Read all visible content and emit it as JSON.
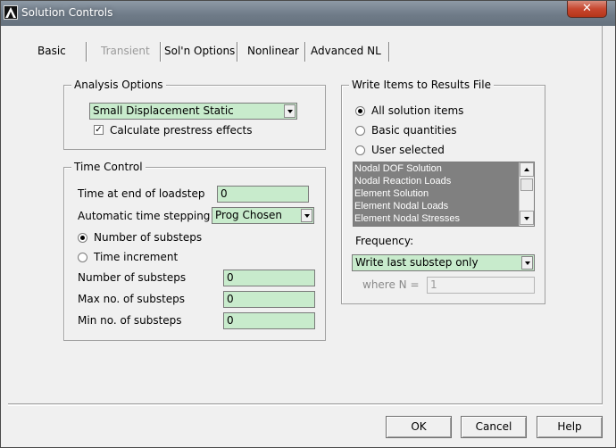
{
  "window": {
    "title": "Solution Controls",
    "close_glyph": "✕"
  },
  "tabs": [
    {
      "label": "Basic",
      "state": "active"
    },
    {
      "label": "Transient",
      "state": "disabled"
    },
    {
      "label": "Sol'n Options",
      "state": "normal"
    },
    {
      "label": "Nonlinear",
      "state": "normal"
    },
    {
      "label": "Advanced NL",
      "state": "normal"
    }
  ],
  "analysis_options": {
    "title": "Analysis Options",
    "analysis_type_value": "Small Displacement Static",
    "prestress_label": "Calculate prestress effects",
    "prestress_checked": true
  },
  "time_control": {
    "title": "Time Control",
    "time_end_label": "Time at end of loadstep",
    "time_end_value": "0",
    "auto_time_label": "Automatic time stepping",
    "auto_time_value": "Prog Chosen",
    "radio_substeps_label": "Number of substeps",
    "radio_time_increment_label": "Time increment",
    "selected_radio": "substeps",
    "num_substeps_label": "Number of substeps",
    "num_substeps_value": "0",
    "max_substeps_label": "Max no. of substeps",
    "max_substeps_value": "0",
    "min_substeps_label": "Min no. of substeps",
    "min_substeps_value": "0"
  },
  "write_items": {
    "title": "Write Items to Results File",
    "radio_all_label": "All solution items",
    "radio_basic_label": "Basic quantities",
    "radio_user_label": "User selected",
    "selected_radio": "all",
    "list_items": [
      "Nodal DOF Solution",
      "Nodal Reaction Loads",
      "Element Solution",
      "Element Nodal Loads",
      "Element Nodal Stresses"
    ],
    "frequency_label": "Frequency:",
    "frequency_value": "Write last substep only",
    "where_n_label": "where N =",
    "where_n_value": "1"
  },
  "buttons": {
    "ok": "OK",
    "cancel": "Cancel",
    "help": "Help"
  },
  "colors": {
    "field_green": "#c8ebcc",
    "list_selected_bg": "#808080",
    "close_red": "#c7472f",
    "titlebar": "#77838f"
  }
}
